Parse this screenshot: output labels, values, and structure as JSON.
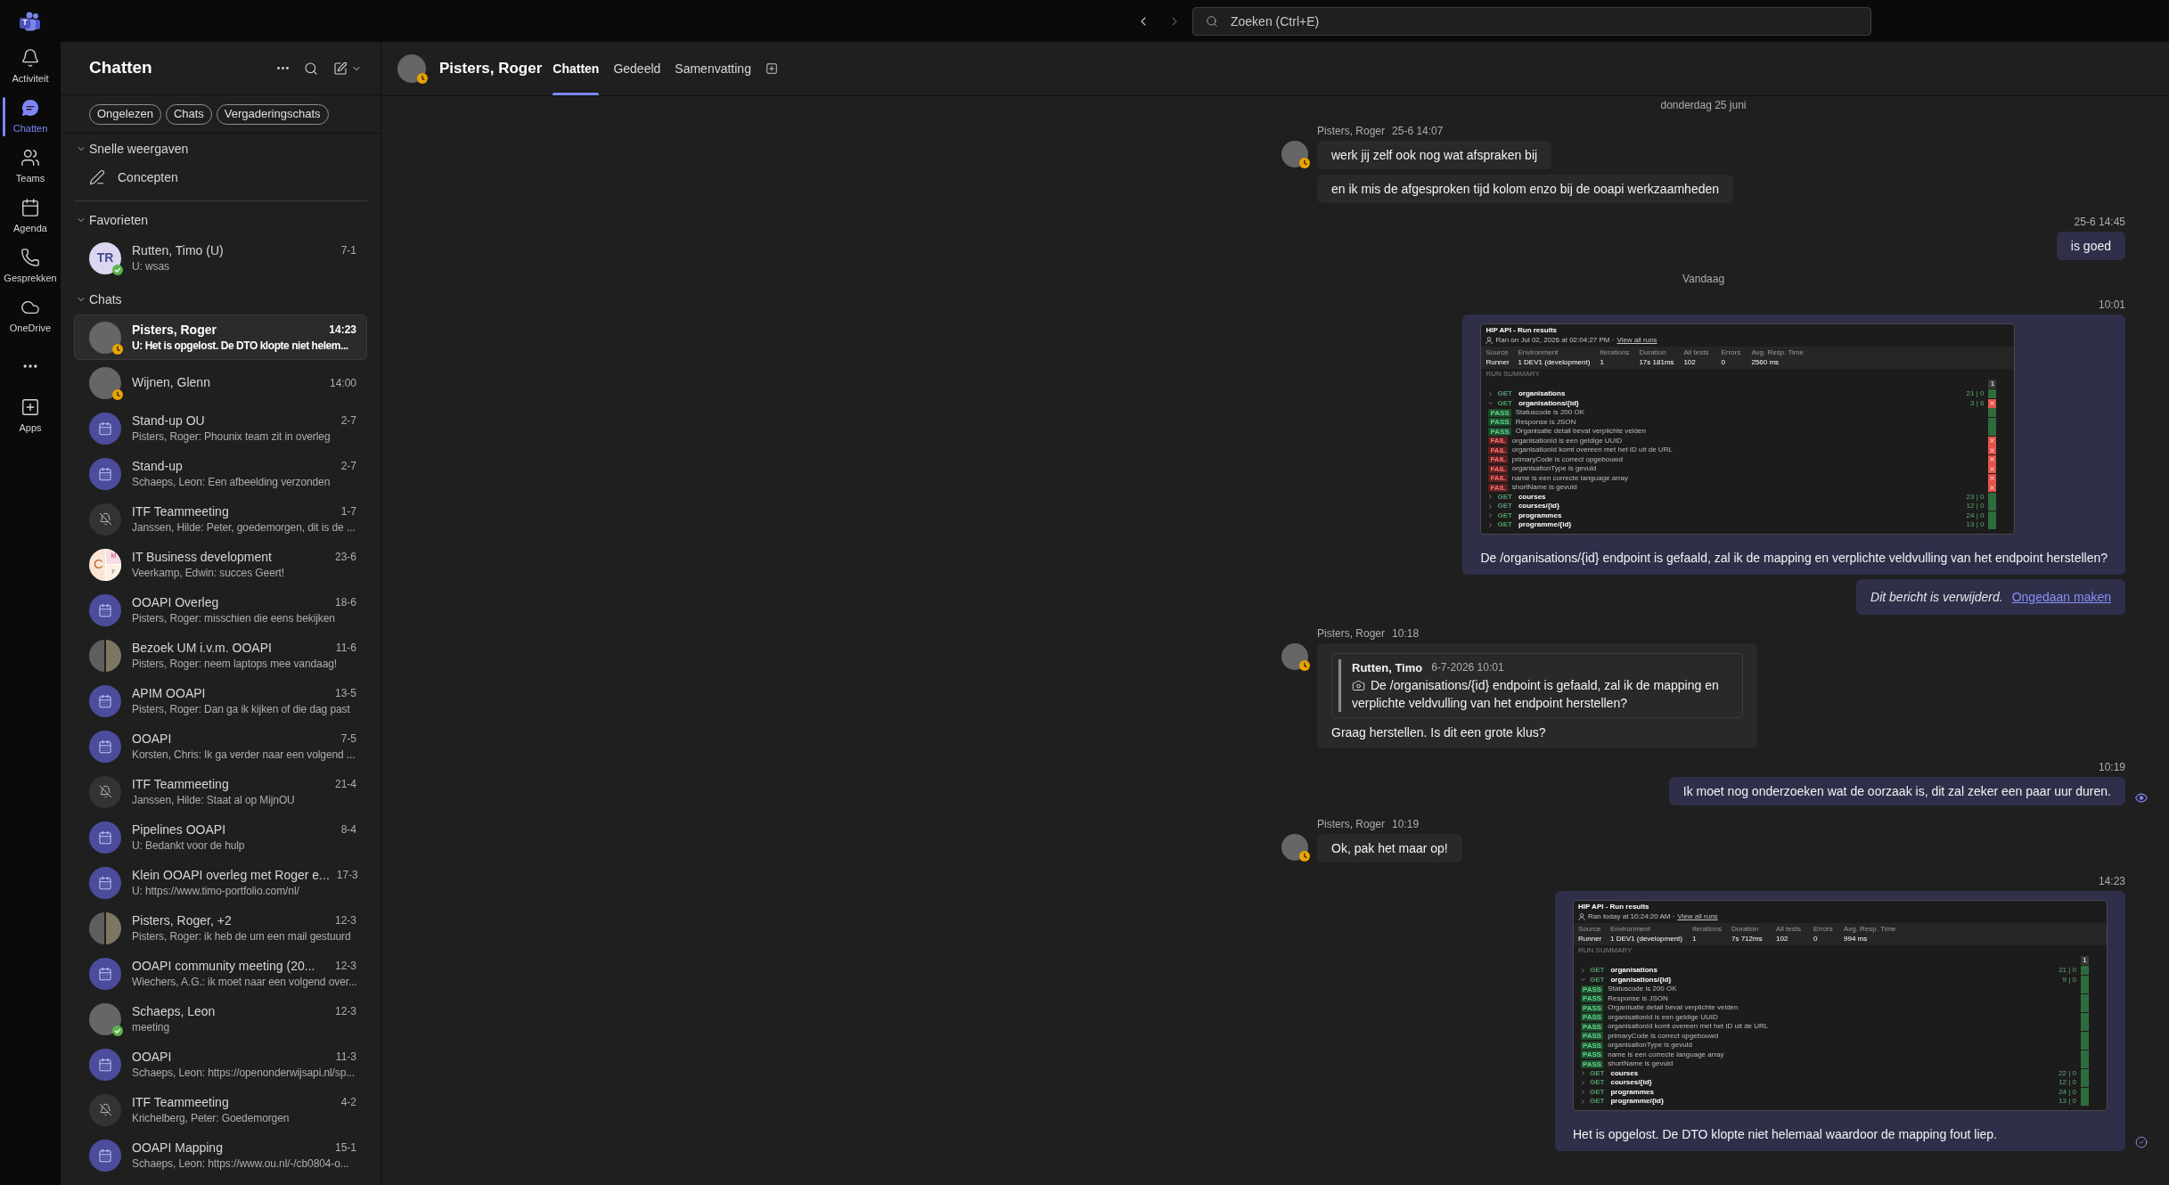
{
  "app": {
    "logo_letter": "T"
  },
  "top_bar": {
    "back": {
      "disabled": false
    },
    "forward": {
      "disabled": true
    },
    "search": {
      "placeholder": "Zoeken (Ctrl+E)"
    }
  },
  "rail": {
    "items": [
      {
        "label": "Activiteit",
        "selected": false
      },
      {
        "label": "Chatten",
        "selected": true
      },
      {
        "label": "Teams",
        "selected": false
      },
      {
        "label": "Agenda",
        "selected": false
      },
      {
        "label": "Gesprekken",
        "selected": false
      },
      {
        "label": "OneDrive",
        "selected": false
      }
    ],
    "apps": {
      "label": "Apps",
      "selected": false
    }
  },
  "chat_list": {
    "title": "Chatten",
    "filters": [
      {
        "label": "Ongelezen",
        "selected": false
      },
      {
        "label": "Chats",
        "selected": false
      },
      {
        "label": "Vergaderingschats",
        "selected": false
      }
    ],
    "sections": [
      {
        "title": "Snelle weergaven",
        "expanded": true,
        "items": [
          {
            "kind": "view",
            "label": "Concepten"
          }
        ]
      },
      {
        "title": "Favorieten",
        "expanded": true,
        "items": [
          {
            "kind": "chat",
            "name": "Rutten, Timo (U)",
            "time": "7-1",
            "preview": "U: wsas",
            "avatar": {
              "kind": "initials",
              "initials": "TR",
              "presence": {
                "kind": "available",
                "color": "#5bb34a"
              }
            },
            "selected": false,
            "unread": false
          }
        ]
      },
      {
        "title": "Chats",
        "expanded": true,
        "items": [
          {
            "kind": "chat",
            "name": "Pisters, Roger",
            "time": "14:23",
            "preview": "U: Het is opgelost. De DTO klopte niet helem...",
            "avatar": {
              "kind": "photo",
              "presence": {
                "kind": "away",
                "color": "#eaa300"
              }
            },
            "selected": true,
            "unread": true
          },
          {
            "kind": "chat",
            "name": "Wijnen, Glenn",
            "time": "14:00",
            "avatar": {
              "kind": "photo",
              "presence": {
                "kind": "away",
                "color": "#eaa300"
              }
            },
            "selected": false,
            "unread": false
          },
          {
            "kind": "chat",
            "name": "Stand-up OU",
            "time": "2-7",
            "preview": "Pisters, Roger: Phounix team zit in overleg",
            "avatar": {
              "kind": "meeting"
            },
            "selected": false,
            "unread": false
          },
          {
            "kind": "chat",
            "name": "Stand-up",
            "time": "2-7",
            "preview": "Schaeps, Leon: Een afbeelding verzonden",
            "avatar": {
              "kind": "meeting"
            },
            "selected": false,
            "unread": false
          },
          {
            "kind": "chat",
            "name": "ITF Teammeeting",
            "time": "1-7",
            "preview": "Janssen, Hilde: Peter, goedemorgen, dit is de ...",
            "avatar": {
              "kind": "muted"
            },
            "selected": false,
            "unread": false
          },
          {
            "kind": "chat",
            "name": "IT Business development",
            "time": "23-6",
            "preview": "Veerkamp, Edwin: succes Geert!",
            "avatar": {
              "kind": "group-initials",
              "initials": [
                "C",
                "M",
                "F"
              ]
            },
            "selected": false,
            "unread": false
          },
          {
            "kind": "chat",
            "name": "OOAPI Overleg",
            "time": "18-6",
            "preview": "Pisters, Roger: misschien die eens bekijken",
            "avatar": {
              "kind": "meeting"
            },
            "selected": false,
            "unread": false
          },
          {
            "kind": "chat",
            "name": "Bezoek UM i.v.m. OOAPI",
            "time": "11-6",
            "preview": "Pisters, Roger: neem laptops mee vandaag!",
            "avatar": {
              "kind": "group-photo"
            },
            "selected": false,
            "unread": false
          },
          {
            "kind": "chat",
            "name": "APIM OOAPI",
            "time": "13-5",
            "preview": "Pisters, Roger: Dan ga ik kijken of die dag past",
            "avatar": {
              "kind": "meeting"
            },
            "selected": false,
            "unread": false
          },
          {
            "kind": "chat",
            "name": "OOAPI",
            "time": "7-5",
            "preview": "Korsten, Chris: Ik ga verder naar een volgend ...",
            "avatar": {
              "kind": "meeting"
            },
            "selected": false,
            "unread": false
          },
          {
            "kind": "chat",
            "name": "ITF Teammeeting",
            "time": "21-4",
            "preview": "Janssen, Hilde: Staat al op MijnOU",
            "avatar": {
              "kind": "muted"
            },
            "selected": false,
            "unread": false
          },
          {
            "kind": "chat",
            "name": "Pipelines OOAPI",
            "time": "8-4",
            "preview": "U: Bedankt voor de hulp",
            "avatar": {
              "kind": "meeting"
            },
            "selected": false,
            "unread": false
          },
          {
            "kind": "chat",
            "name": "Klein OOAPI overleg met Roger e...",
            "time": "17-3",
            "preview": "U: https://www.timo-portfolio.com/nl/",
            "avatar": {
              "kind": "meeting"
            },
            "selected": false,
            "unread": false
          },
          {
            "kind": "chat",
            "name": "Pisters, Roger, +2",
            "time": "12-3",
            "preview": "Pisters, Roger: ik heb de um een mail gestuurd",
            "avatar": {
              "kind": "group-photo"
            },
            "selected": false,
            "unread": false
          },
          {
            "kind": "chat",
            "name": "OOAPI community meeting (20...",
            "time": "12-3",
            "preview": "Wiechers, A.G.: ik moet naar een volgend over...",
            "avatar": {
              "kind": "meeting"
            },
            "selected": false,
            "unread": false
          },
          {
            "kind": "chat",
            "name": "Schaeps, Leon",
            "time": "12-3",
            "preview": "meeting",
            "avatar": {
              "kind": "photo",
              "presence": {
                "kind": "available",
                "color": "#5bb34a"
              }
            },
            "selected": false,
            "unread": false
          },
          {
            "kind": "chat",
            "name": "OOAPI",
            "time": "11-3",
            "preview": "Schaeps, Leon: https://openonderwijsapi.nl/sp...",
            "avatar": {
              "kind": "meeting"
            },
            "selected": false,
            "unread": false
          },
          {
            "kind": "chat",
            "name": "ITF Teammeeting",
            "time": "4-2",
            "preview": "Krichelberg, Peter: Goedemorgen",
            "avatar": {
              "kind": "muted"
            },
            "selected": false,
            "unread": false
          },
          {
            "kind": "chat",
            "name": "OOAPI Mapping",
            "time": "15-1",
            "preview": "Schaeps, Leon: https://www.ou.nl/-/cb0804-o...",
            "avatar": {
              "kind": "meeting"
            },
            "selected": false,
            "unread": false
          }
        ]
      }
    ]
  },
  "conversation": {
    "avatar": {
      "kind": "photo",
      "presence": {
        "kind": "away",
        "color": "#eaa300"
      }
    },
    "title": "Pisters, Roger",
    "tabs": [
      {
        "label": "Chatten",
        "selected": true
      },
      {
        "label": "Gedeeld",
        "selected": false
      },
      {
        "label": "Samenvatting",
        "selected": false
      }
    ],
    "messages": [
      {
        "kind": "date",
        "text": "donderdag 25 juni"
      },
      {
        "kind": "incoming",
        "sender": "Pisters, Roger",
        "time": "25-6 14:07",
        "avatar": {
          "kind": "photo",
          "presence": {
            "kind": "away",
            "color": "#eaa300"
          }
        },
        "bubbles": [
          {
            "kind": "text",
            "text": "werk jij zelf ook nog wat afspraken bij"
          },
          {
            "kind": "text",
            "text": "en ik mis de afgesproken tijd kolom enzo bij de ooapi werkzaamheden"
          }
        ]
      },
      {
        "kind": "outgoing",
        "time": "25-6 14:45",
        "bubbles": [
          {
            "kind": "text",
            "text": "is goed"
          }
        ]
      },
      {
        "kind": "date",
        "text": "Vandaag"
      },
      {
        "kind": "outgoing",
        "time": "10:01",
        "bubbles": [
          {
            "kind": "image",
            "attachment": {
              "title": "HIP API - Run results",
              "run_info": "Ran on Jul 02, 2026 at 02:04:27 PM ·",
              "link": "View all runs",
              "stats": [
                {
                  "label": "Source",
                  "value": "Runner"
                },
                {
                  "label": "Environment",
                  "value": "1 DEV1 (development)"
                },
                {
                  "label": "Iterations",
                  "value": "1"
                },
                {
                  "label": "Duration",
                  "value": "17s 181ms"
                },
                {
                  "label": "All tests",
                  "value": "102"
                },
                {
                  "label": "Errors",
                  "value": "0"
                },
                {
                  "label": "Avg. Resp. Time",
                  "value": "2560 ms"
                }
              ],
              "section": "RUN SUMMARY",
              "column": "1",
              "rows": [
                {
                  "kind": "request",
                  "expanded": false,
                  "method": "GET",
                  "name": "organisations",
                  "counts": "21 | 0",
                  "passed": true
                },
                {
                  "kind": "request",
                  "expanded": true,
                  "method": "GET",
                  "name": "organisations/{id}",
                  "counts": "3 | 6",
                  "passed": false
                },
                {
                  "kind": "test",
                  "status": "PASS",
                  "name": "Statuscode is 200 OK",
                  "passed": true
                },
                {
                  "kind": "test",
                  "status": "PASS",
                  "name": "Response is JSON",
                  "passed": true
                },
                {
                  "kind": "test",
                  "status": "PASS",
                  "name": "Organisatie detail bevat verplichte velden",
                  "passed": true
                },
                {
                  "kind": "test",
                  "status": "FAIL",
                  "name": "organisationId is een geldige UUID",
                  "passed": false
                },
                {
                  "kind": "test",
                  "status": "FAIL",
                  "name": "organisationId komt overeen met het ID uit de URL",
                  "passed": false
                },
                {
                  "kind": "test",
                  "status": "FAIL",
                  "name": "primaryCode is correct opgebouwd",
                  "passed": false
                },
                {
                  "kind": "test",
                  "status": "FAIL",
                  "name": "organisationType is gevuld",
                  "passed": false
                },
                {
                  "kind": "test",
                  "status": "FAIL",
                  "name": "name is een correcte language array",
                  "passed": false
                },
                {
                  "kind": "test",
                  "status": "FAIL",
                  "name": "shortName is gevuld",
                  "passed": false
                },
                {
                  "kind": "request",
                  "expanded": false,
                  "method": "GET",
                  "name": "courses",
                  "counts": "23 | 0",
                  "passed": true
                },
                {
                  "kind": "request",
                  "expanded": false,
                  "method": "GET",
                  "name": "courses/{id}",
                  "counts": "12 | 0",
                  "passed": true
                },
                {
                  "kind": "request",
                  "expanded": false,
                  "method": "GET",
                  "name": "programmes",
                  "counts": "24 | 0",
                  "passed": true
                },
                {
                  "kind": "request",
                  "expanded": false,
                  "method": "GET",
                  "name": "programme/{id}",
                  "counts": "13 | 0",
                  "passed": true
                }
              ]
            },
            "text": "De /organisations/{id} endpoint is gefaald, zal ik de mapping en verplichte veldvulling van het endpoint herstellen?"
          },
          {
            "kind": "deleted",
            "text": "Dit bericht is verwijderd.",
            "link": "Ongedaan maken"
          }
        ]
      },
      {
        "kind": "incoming",
        "sender": "Pisters, Roger",
        "time": "10:18",
        "avatar": {
          "kind": "photo",
          "presence": {
            "kind": "away",
            "color": "#eaa300"
          }
        },
        "bubbles": [
          {
            "kind": "quote",
            "quote": {
              "author": "Rutten, Timo",
              "time": "6-7-2026 10:01",
              "image": true,
              "text": "De /organisations/{id} endpoint is gefaald, zal ik de mapping en verplichte veldvulling van het endpoint herstellen?"
            },
            "text": "Graag herstellen. Is dit een grote klus?"
          }
        ]
      },
      {
        "kind": "outgoing",
        "time": "10:19",
        "receipt": {
          "kind": "seen"
        },
        "bubbles": [
          {
            "kind": "text",
            "text": "Ik moet nog onderzoeken wat de oorzaak is, dit zal zeker een paar uur duren."
          }
        ]
      },
      {
        "kind": "incoming",
        "sender": "Pisters, Roger",
        "time": "10:19",
        "avatar": {
          "kind": "photo",
          "presence": {
            "kind": "away",
            "color": "#eaa300"
          }
        },
        "bubbles": [
          {
            "kind": "text",
            "text": "Ok, pak het maar op!"
          }
        ]
      },
      {
        "kind": "outgoing",
        "time": "14:23",
        "receipt": {
          "kind": "delivered"
        },
        "bubbles": [
          {
            "kind": "image",
            "attachment": {
              "title": "HIP API - Run results",
              "run_info": "Ran today at 10:24:20 AM ·",
              "link": "View all runs",
              "stats": [
                {
                  "label": "Source",
                  "value": "Runner"
                },
                {
                  "label": "Environment",
                  "value": "1 DEV1 (development)"
                },
                {
                  "label": "Iterations",
                  "value": "1"
                },
                {
                  "label": "Duration",
                  "value": "7s 712ms"
                },
                {
                  "label": "All tests",
                  "value": "102"
                },
                {
                  "label": "Errors",
                  "value": "0"
                },
                {
                  "label": "Avg. Resp. Time",
                  "value": "994 ms"
                }
              ],
              "section": "RUN SUMMARY",
              "column": "1",
              "rows": [
                {
                  "kind": "request",
                  "expanded": false,
                  "method": "GET",
                  "name": "organisations",
                  "counts": "21 | 0",
                  "passed": true
                },
                {
                  "kind": "request",
                  "expanded": true,
                  "method": "GET",
                  "name": "organisations/{id}",
                  "counts": "9 | 0",
                  "passed": true
                },
                {
                  "kind": "test",
                  "status": "PASS",
                  "name": "Statuscode is 200 OK",
                  "passed": true
                },
                {
                  "kind": "test",
                  "status": "PASS",
                  "name": "Response is JSON",
                  "passed": true
                },
                {
                  "kind": "test",
                  "status": "PASS",
                  "name": "Organisatie detail bevat verplichte velden",
                  "passed": true
                },
                {
                  "kind": "test",
                  "status": "PASS",
                  "name": "organisationId is een geldige UUID",
                  "passed": true
                },
                {
                  "kind": "test",
                  "status": "PASS",
                  "name": "organisationId komt overeen met het ID uit de URL",
                  "passed": true
                },
                {
                  "kind": "test",
                  "status": "PASS",
                  "name": "primaryCode is correct opgebouwd",
                  "passed": true
                },
                {
                  "kind": "test",
                  "status": "PASS",
                  "name": "organisationType is gevuld",
                  "passed": true
                },
                {
                  "kind": "test",
                  "status": "PASS",
                  "name": "name is een correcte language array",
                  "passed": true
                },
                {
                  "kind": "test",
                  "status": "PASS",
                  "name": "shortName is gevuld",
                  "passed": true
                },
                {
                  "kind": "request",
                  "expanded": false,
                  "method": "GET",
                  "name": "courses",
                  "counts": "22 | 0",
                  "passed": true
                },
                {
                  "kind": "request",
                  "expanded": false,
                  "method": "GET",
                  "name": "courses/{id}",
                  "counts": "12 | 0",
                  "passed": true
                },
                {
                  "kind": "request",
                  "expanded": false,
                  "method": "GET",
                  "name": "programmes",
                  "counts": "24 | 0",
                  "passed": true
                },
                {
                  "kind": "request",
                  "expanded": false,
                  "method": "GET",
                  "name": "programme/{id}",
                  "counts": "13 | 0",
                  "passed": true
                }
              ]
            },
            "text": "Het is opgelost. De DTO klopte niet helemaal waardoor de mapping fout liep."
          }
        ]
      }
    ]
  }
}
